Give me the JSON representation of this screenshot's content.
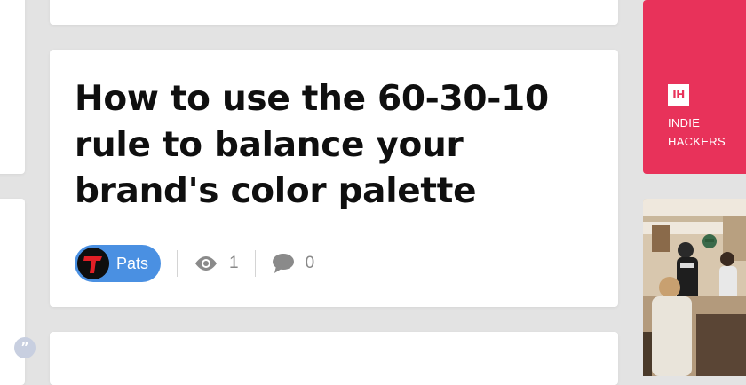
{
  "post": {
    "title": "How to use the 60-30-10 rule to balance your brand's color palette",
    "author": {
      "name": "Pats",
      "avatar_icon": "t-logo-icon"
    },
    "views": "1",
    "comments": "0"
  },
  "promo": {
    "logo": "IH",
    "line1": "INDIE",
    "line2": "HACKERS"
  },
  "colors": {
    "author_pill": "#4a90e2",
    "promo_bg": "#e8325a",
    "page_bg": "#e3e3e3"
  }
}
